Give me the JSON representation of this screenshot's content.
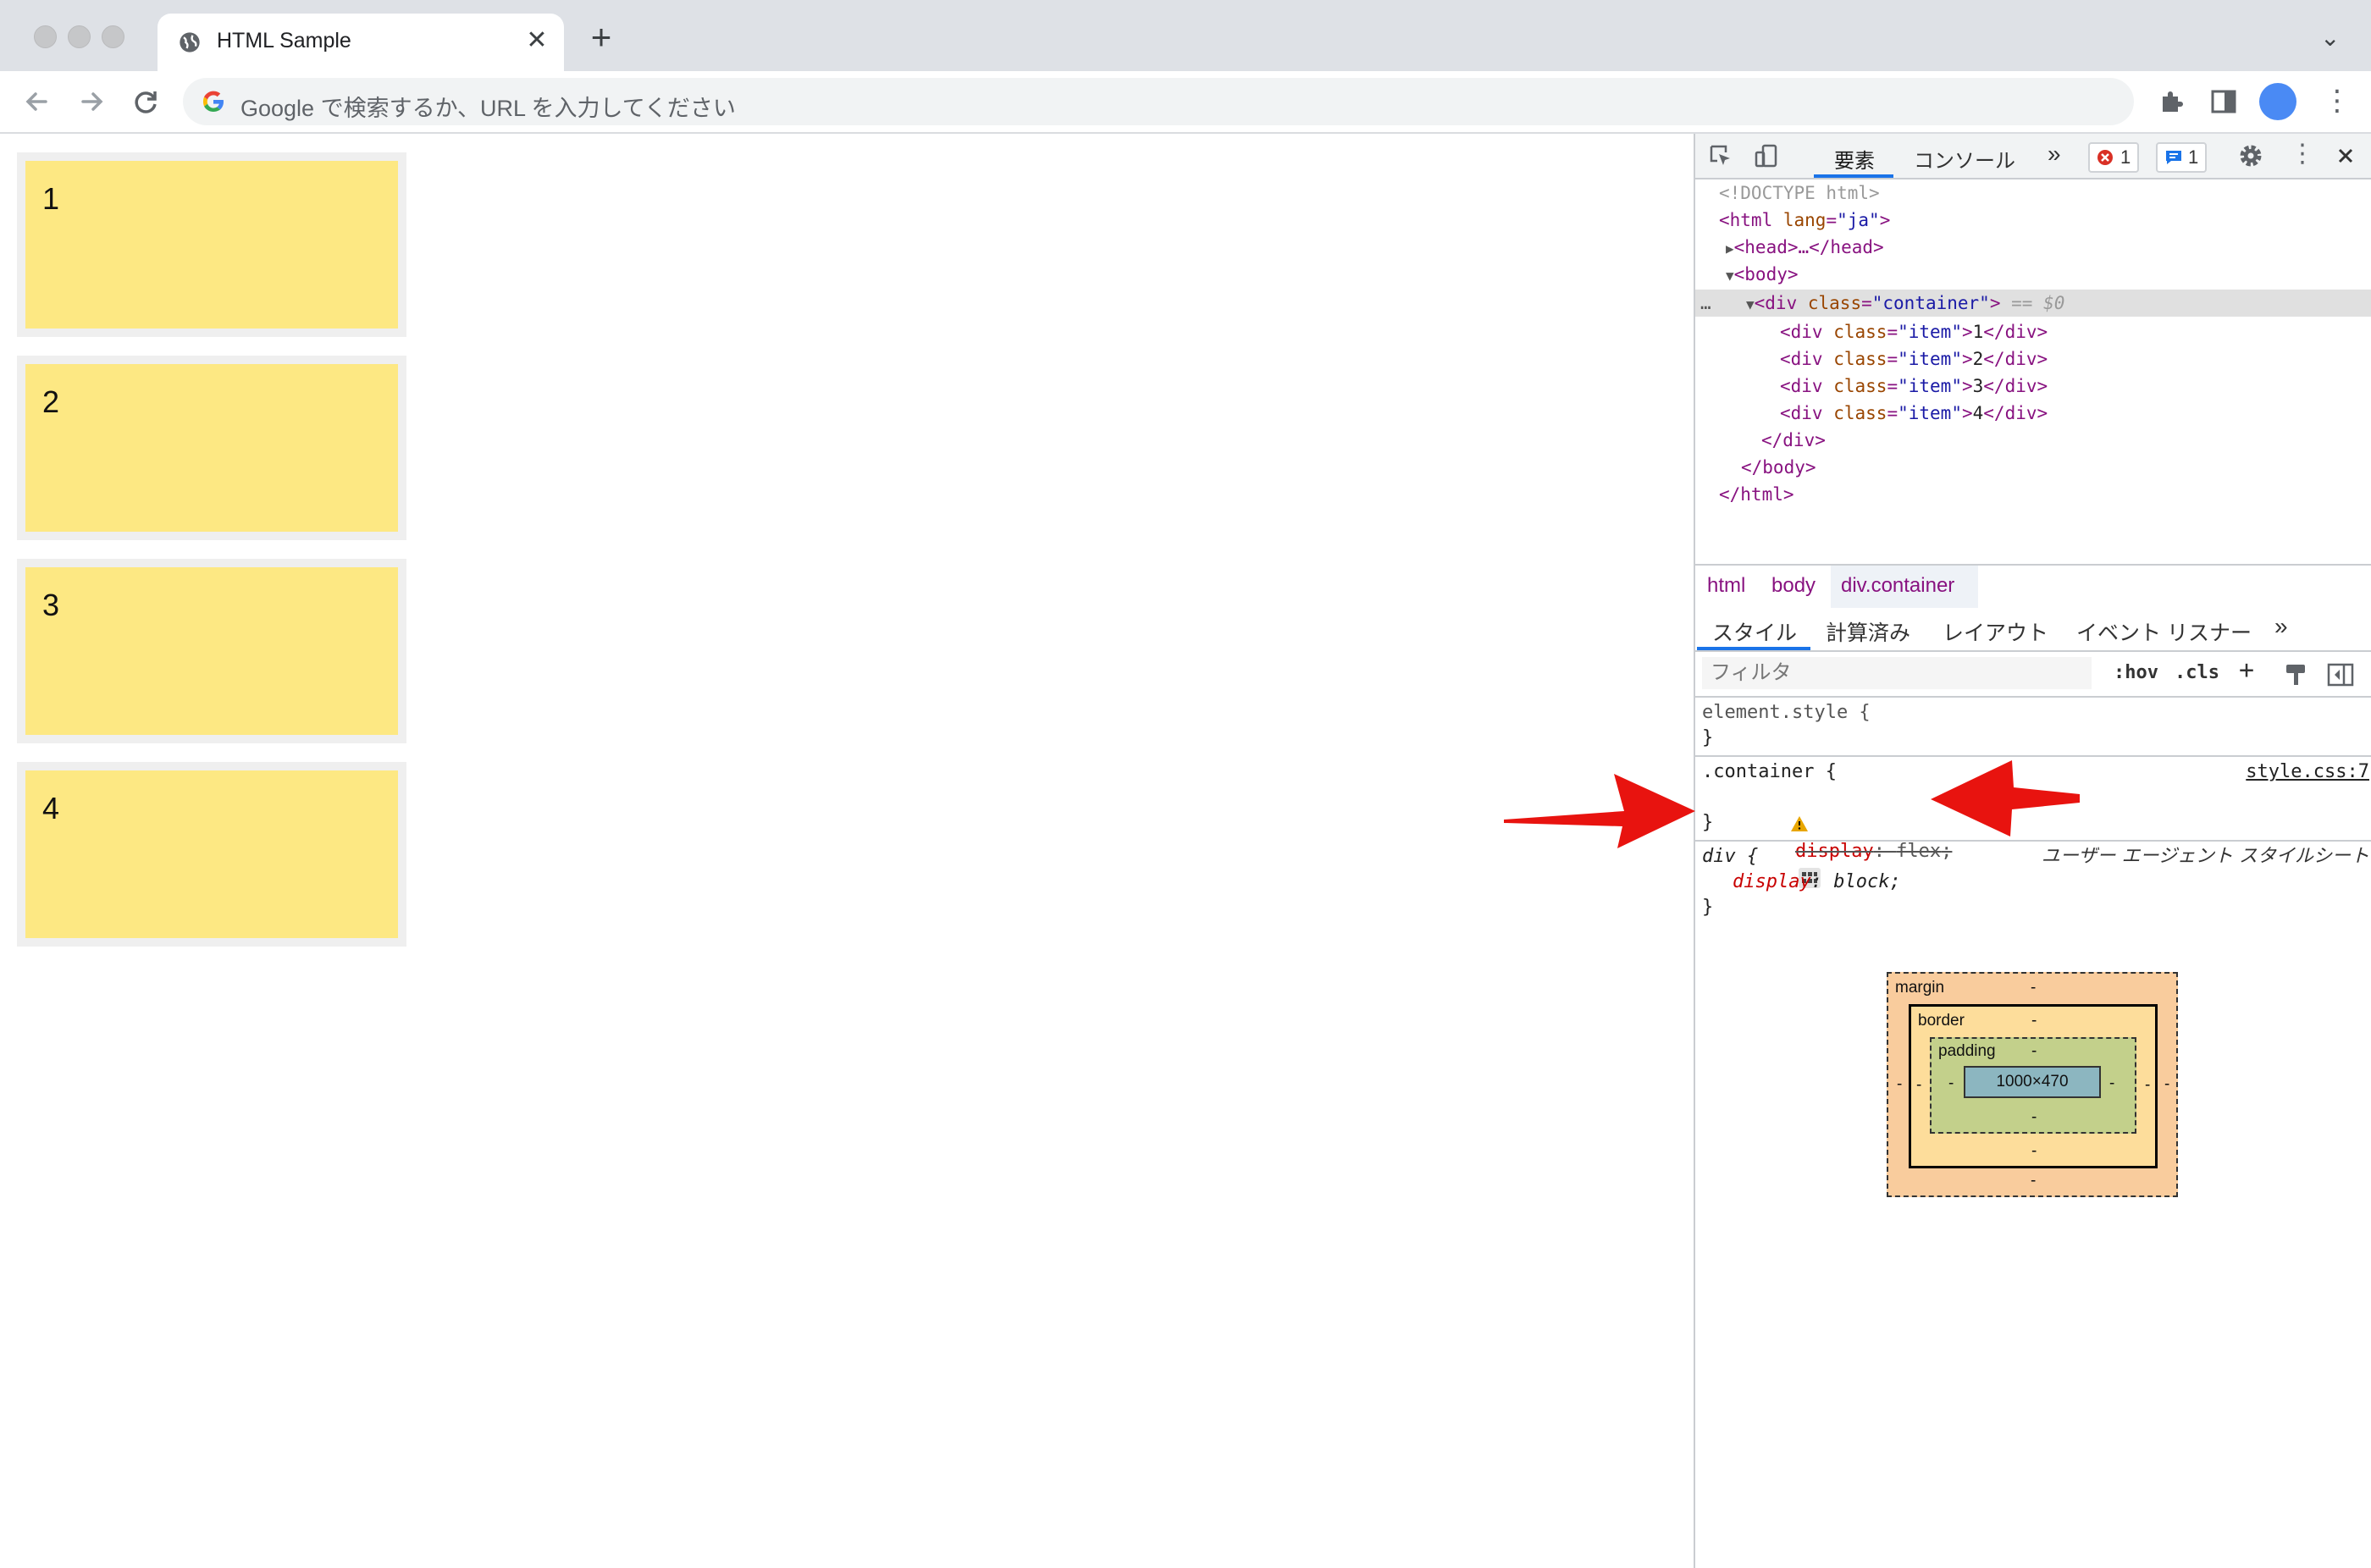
{
  "browser": {
    "tab": {
      "title": "HTML Sample",
      "close": "✕"
    },
    "new_tab": "+",
    "tab_menu": "⌄",
    "omnibox": {
      "placeholder": "Google で検索するか、URL を入力してください"
    },
    "kebab": "⋮",
    "avatar_color": "#4a8af4"
  },
  "page": {
    "items": [
      {
        "label": "1"
      },
      {
        "label": "2"
      },
      {
        "label": "3"
      },
      {
        "label": "4"
      }
    ],
    "item_color": "#fde883"
  },
  "devtools": {
    "tabs": {
      "elements": "要素",
      "console": "コンソール",
      "more": "»"
    },
    "errors_count": "1",
    "messages_count": "1",
    "dom": {
      "doctype": "<!DOCTYPE html>",
      "html_open_tag": "<html",
      "html_attr": "lang",
      "html_attr_val": "\"ja\"",
      "head": "<head>…</head>",
      "body_open": "<body>",
      "div_open_tag": "<div",
      "div_attr": "class",
      "div_attr_val": "\"container\"",
      "selected_marker": "== $0",
      "dots": "…",
      "children": [
        {
          "open": "<div",
          "attr": "class",
          "val": "\"item\"",
          "text": "1",
          "close": "</div>"
        },
        {
          "open": "<div",
          "attr": "class",
          "val": "\"item\"",
          "text": "2",
          "close": "</div>"
        },
        {
          "open": "<div",
          "attr": "class",
          "val": "\"item\"",
          "text": "3",
          "close": "</div>"
        },
        {
          "open": "<div",
          "attr": "class",
          "val": "\"item\"",
          "text": "4",
          "close": "</div>"
        }
      ],
      "div_close": "</div>",
      "body_close": "</body>",
      "html_close": "</html>"
    },
    "breadcrumb": [
      "html",
      "body",
      "div.container"
    ],
    "styles_tabs": {
      "styles": "スタイル",
      "computed": "計算済み",
      "layout": "レイアウト",
      "listeners": "イベント リスナー",
      "more": "»"
    },
    "filter": {
      "placeholder": "フィルタ",
      "hov": ":hov",
      "cls": ".cls",
      "plus": "+"
    },
    "rules": {
      "element_style": {
        "selector": "element.style {",
        "close": "}"
      },
      "container": {
        "selector": ".container {",
        "source": "style.css:7",
        "prop": "display",
        "value": "flex",
        "close": "}"
      },
      "div": {
        "selector": "div {",
        "source": "ユーザー エージェント スタイルシート",
        "prop": "display",
        "value": "block",
        "close": "}"
      }
    },
    "box_model": {
      "margin_label": "margin",
      "border_label": "border",
      "padding_label": "padding",
      "content_size": "1000×470",
      "dash": "-"
    }
  },
  "annotations": {
    "arrow_color": "#e8130f"
  }
}
